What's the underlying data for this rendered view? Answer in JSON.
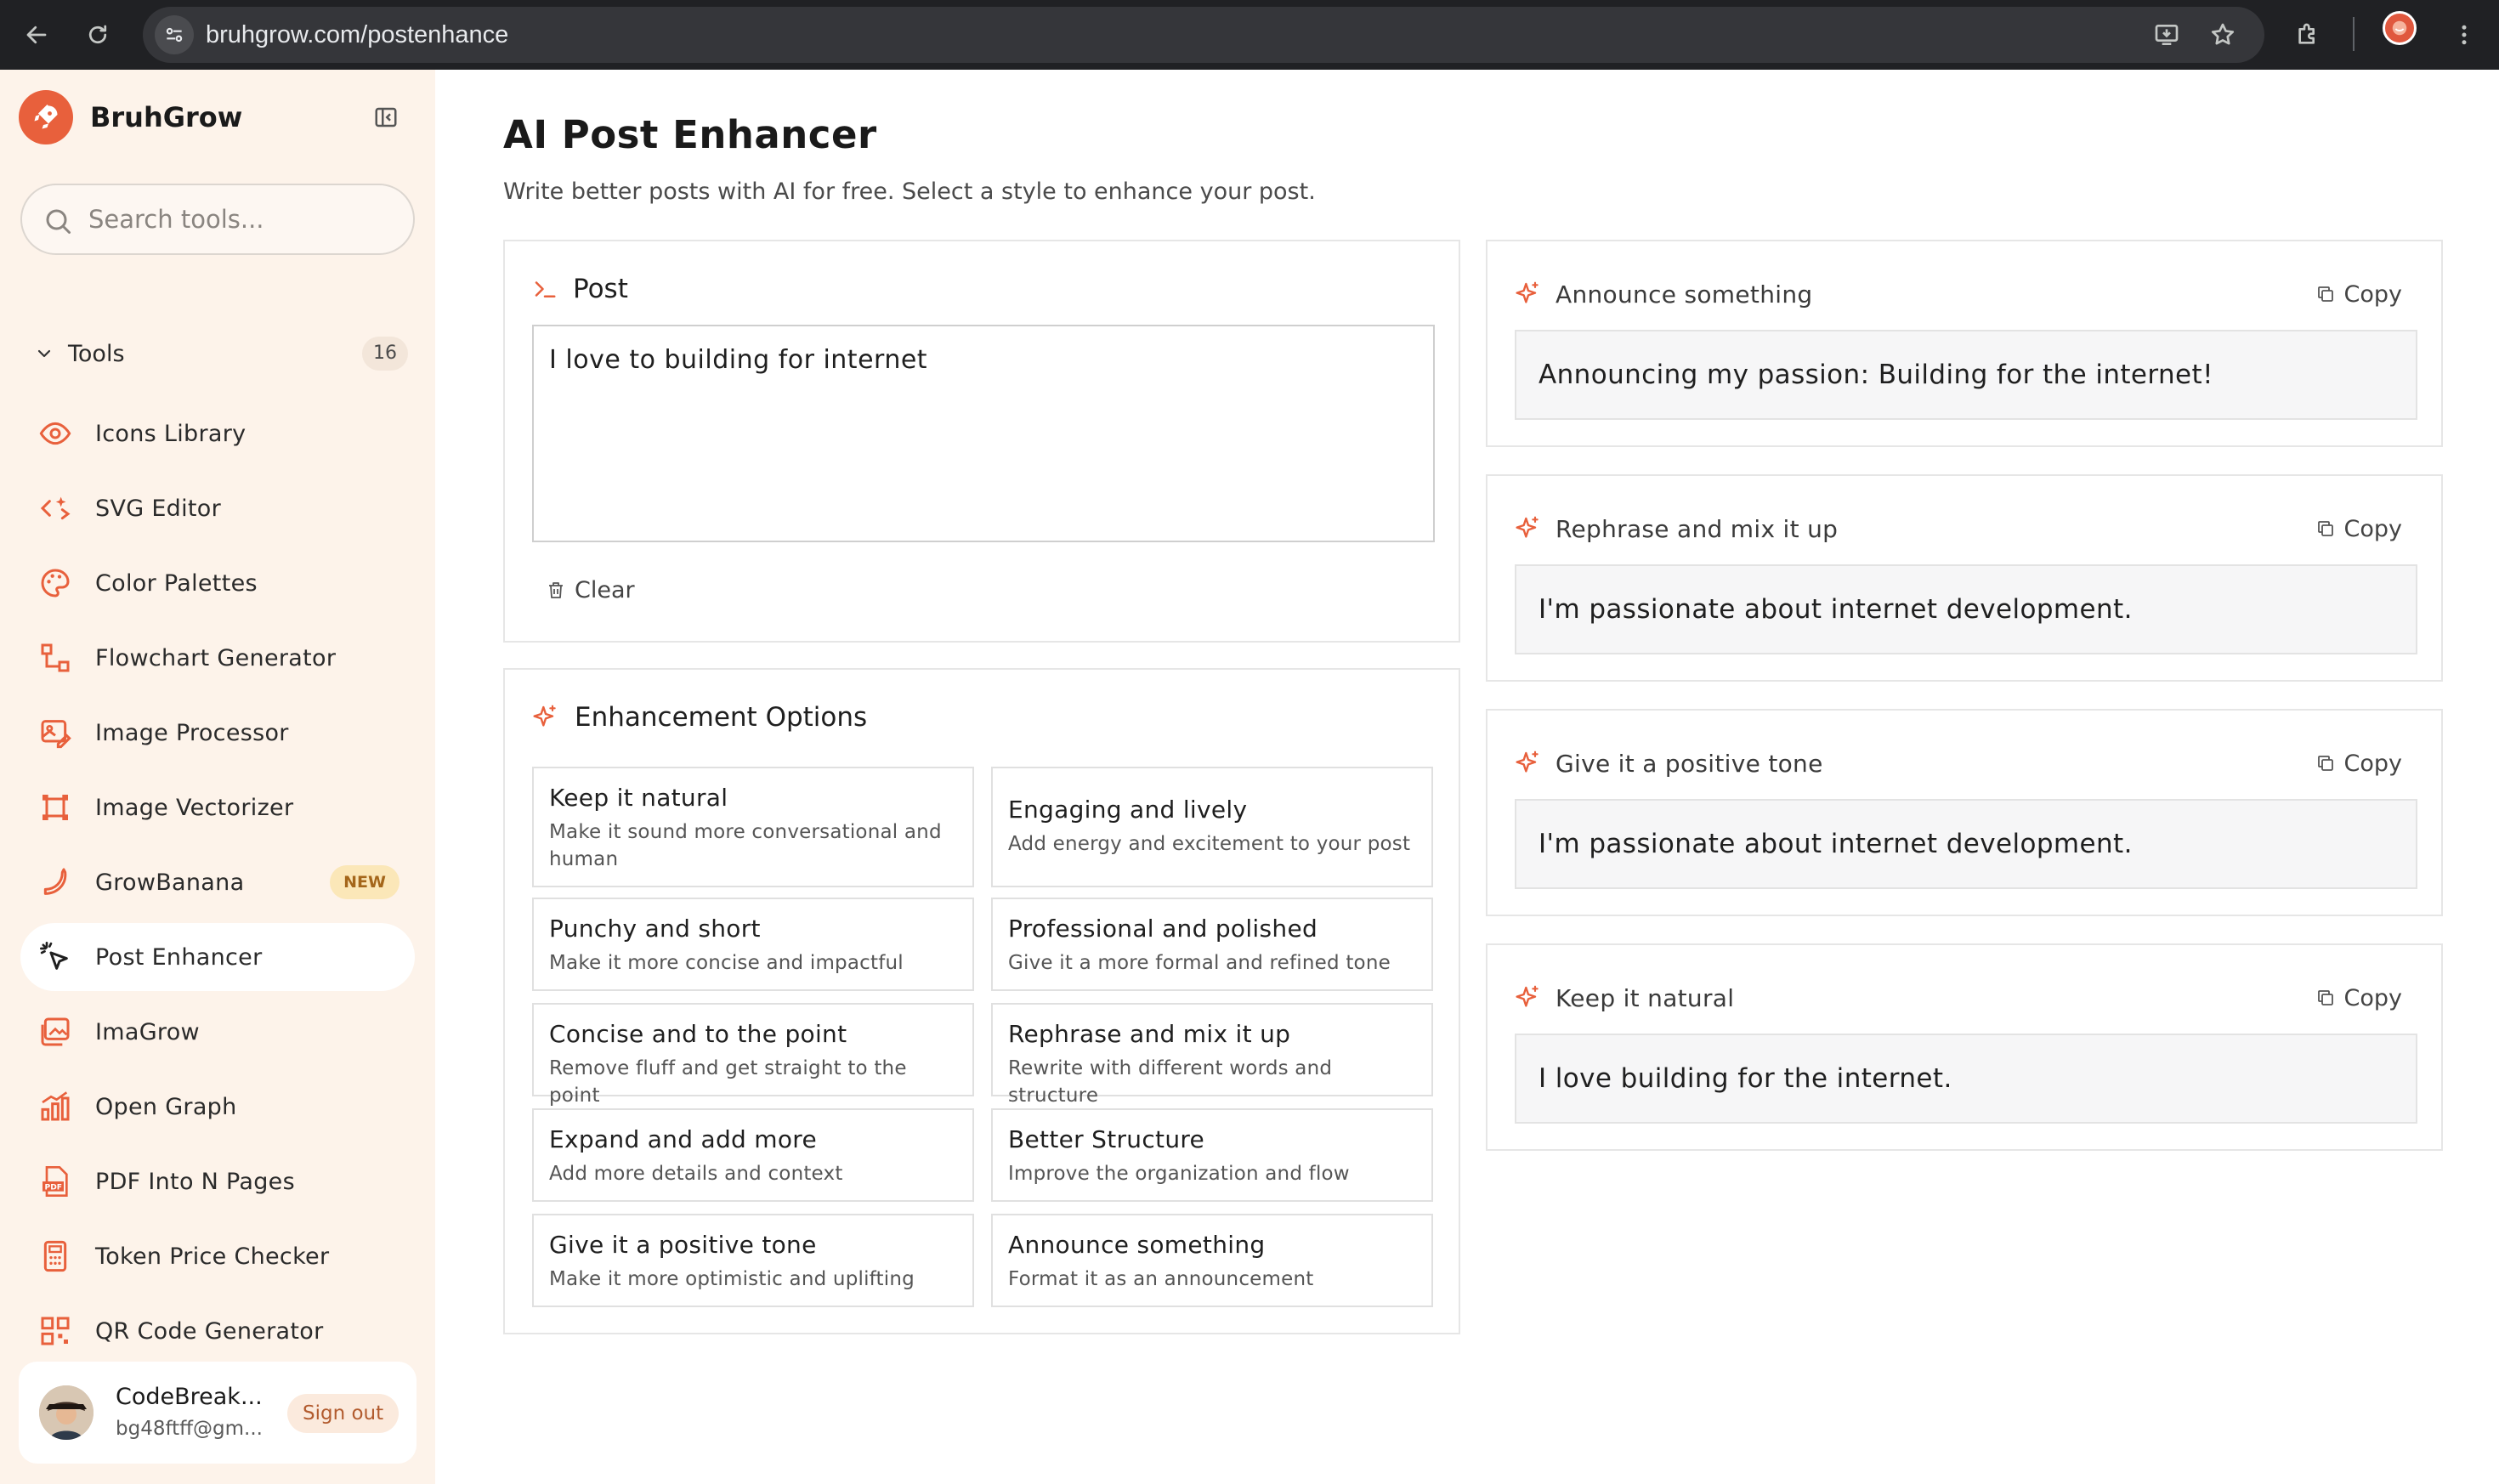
{
  "browser": {
    "url": "bruhgrow.com/postenhance"
  },
  "sidebar": {
    "brand": "BruhGrow",
    "search_placeholder": "Search tools...",
    "tools_label": "Tools",
    "tools_count": "16",
    "items": [
      {
        "label": "Icons Library",
        "icon": "eye-icon"
      },
      {
        "label": "SVG Editor",
        "icon": "code-sparkle-icon"
      },
      {
        "label": "Color Palettes",
        "icon": "palette-icon"
      },
      {
        "label": "Flowchart Generator",
        "icon": "flowchart-icon"
      },
      {
        "label": "Image Processor",
        "icon": "image-edit-icon"
      },
      {
        "label": "Image Vectorizer",
        "icon": "vector-frame-icon"
      },
      {
        "label": "GrowBanana",
        "icon": "banana-icon",
        "badge": "NEW"
      },
      {
        "label": "Post Enhancer",
        "icon": "cursor-sparkle-icon",
        "active": true
      },
      {
        "label": "ImaGrow",
        "icon": "images-icon"
      },
      {
        "label": "Open Graph",
        "icon": "bar-chart-icon"
      },
      {
        "label": "PDF Into N Pages",
        "icon": "pdf-icon"
      },
      {
        "label": "Token Price Checker",
        "icon": "calculator-icon"
      },
      {
        "label": "QR Code Generator",
        "icon": "qr-code-icon"
      }
    ],
    "user": {
      "name": "CodeBreak...",
      "email": "bg48ftff@gm...",
      "signout_label": "Sign out"
    }
  },
  "main": {
    "title": "AI Post Enhancer",
    "subtitle": "Write better posts with AI for free. Select a style to enhance your post.",
    "post": {
      "heading": "Post",
      "text": "I love to building for internet",
      "clear_label": "Clear"
    },
    "options": {
      "heading": "Enhancement Options",
      "items": [
        {
          "title": "Keep it natural",
          "desc": "Make it sound more conversational and human"
        },
        {
          "title": "Engaging and lively",
          "desc": "Add energy and excitement to your post"
        },
        {
          "title": "Punchy and short",
          "desc": "Make it more concise and impactful"
        },
        {
          "title": "Professional and polished",
          "desc": "Give it a more formal and refined tone"
        },
        {
          "title": "Concise and to the point",
          "desc": "Remove fluff and get straight to the point"
        },
        {
          "title": "Rephrase and mix it up",
          "desc": "Rewrite with different words and structure"
        },
        {
          "title": "Expand and add more",
          "desc": "Add more details and context"
        },
        {
          "title": "Better Structure",
          "desc": "Improve the organization and flow"
        },
        {
          "title": "Give it a positive tone",
          "desc": "Make it more optimistic and uplifting"
        },
        {
          "title": "Announce something",
          "desc": "Format it as an announcement"
        }
      ]
    },
    "results": [
      {
        "style": "Announce something",
        "text": "Announcing my passion: Building for the internet!",
        "copy_label": "Copy"
      },
      {
        "style": "Rephrase and mix it up",
        "text": "I'm passionate about internet development.",
        "copy_label": "Copy"
      },
      {
        "style": "Give it a positive tone",
        "text": "I'm passionate about internet development.",
        "copy_label": "Copy"
      },
      {
        "style": "Keep it natural",
        "text": "I love building for the internet.",
        "copy_label": "Copy"
      }
    ]
  },
  "colors": {
    "accent": "#e8603c",
    "sidebar_bg": "#fdf3ea",
    "chrome_bg": "#202124"
  }
}
